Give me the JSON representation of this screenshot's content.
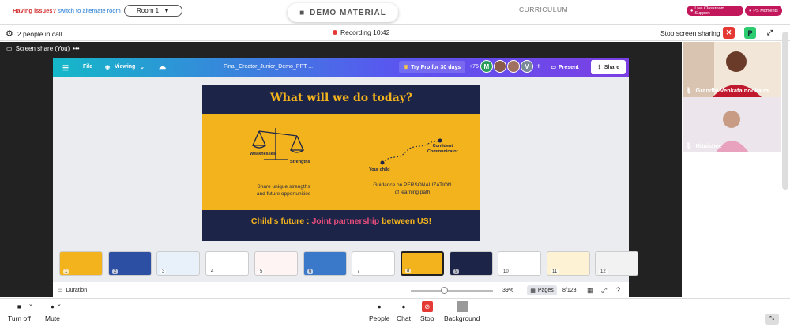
{
  "topbar": {
    "issues_text": "Having issues?",
    "issues_link": "switch to alternate room",
    "room_select": "Room 1",
    "demo_material": "DEMO MATERIAL",
    "curriculum": "CURRICULUM",
    "live_support": "Live Classroom Support",
    "ps_moments": "PS Moments"
  },
  "callbar": {
    "people_in_call": "2 people in call",
    "recording": "Recording 10:42",
    "stop_sharing": "Stop screen sharing",
    "participant_initial": "P"
  },
  "share": {
    "label": "Screen share (You)",
    "more": "•••"
  },
  "canva": {
    "file": "File",
    "viewing": "Viewing",
    "doc_title": "Final_Creator_Junior_Demo_PPT ...",
    "try_pro": "Try Pro for 30 days",
    "collab_count": "+75",
    "avatar_m": "M",
    "avatar_v": "V",
    "plus": "+",
    "present": "Present",
    "share": "Share",
    "duration": "Duration",
    "zoom": "39%",
    "pages_label": "Pages",
    "page_count": "8/123"
  },
  "slide": {
    "title": "What will we do today?",
    "weaknesses": "Weaknesses",
    "strengths": "Strengths",
    "your_child": "Your child",
    "confident": "Confident",
    "communicator": "Communicator",
    "left_line1": "Share unique strengths",
    "left_line2": "and future opportunities",
    "right_line1": "Guidance on PERSONALIZATION",
    "right_line2": "of learning path",
    "footer_a": "Child's future : ",
    "footer_b": "Joint partnership",
    "footer_c": " between US!"
  },
  "thumbnails": [
    {
      "num": "1",
      "bg": "#f3b31c"
    },
    {
      "num": "2",
      "bg": "#2d4fa3"
    },
    {
      "num": "3",
      "bg": "#e8f0fa"
    },
    {
      "num": "4",
      "bg": "#ffffff"
    },
    {
      "num": "5",
      "bg": "#fff4f4"
    },
    {
      "num": "6",
      "bg": "#3a79c9"
    },
    {
      "num": "7",
      "bg": "#ffffff"
    },
    {
      "num": "8",
      "bg": "#f3b31c"
    },
    {
      "num": "9",
      "bg": "#1c2448"
    },
    {
      "num": "10",
      "bg": "#ffffff"
    },
    {
      "num": "11",
      "bg": "#fdf3d4"
    },
    {
      "num": "12",
      "bg": "#f2f2f2"
    }
  ],
  "videos": [
    {
      "name": "Grandhi Venkata nooka ra..."
    },
    {
      "name": "Hitaishee"
    }
  ],
  "toolbar": {
    "turn_off": "Turn off",
    "mute": "Mute",
    "people": "People",
    "chat": "Chat",
    "stop": "Stop",
    "background": "Background"
  }
}
